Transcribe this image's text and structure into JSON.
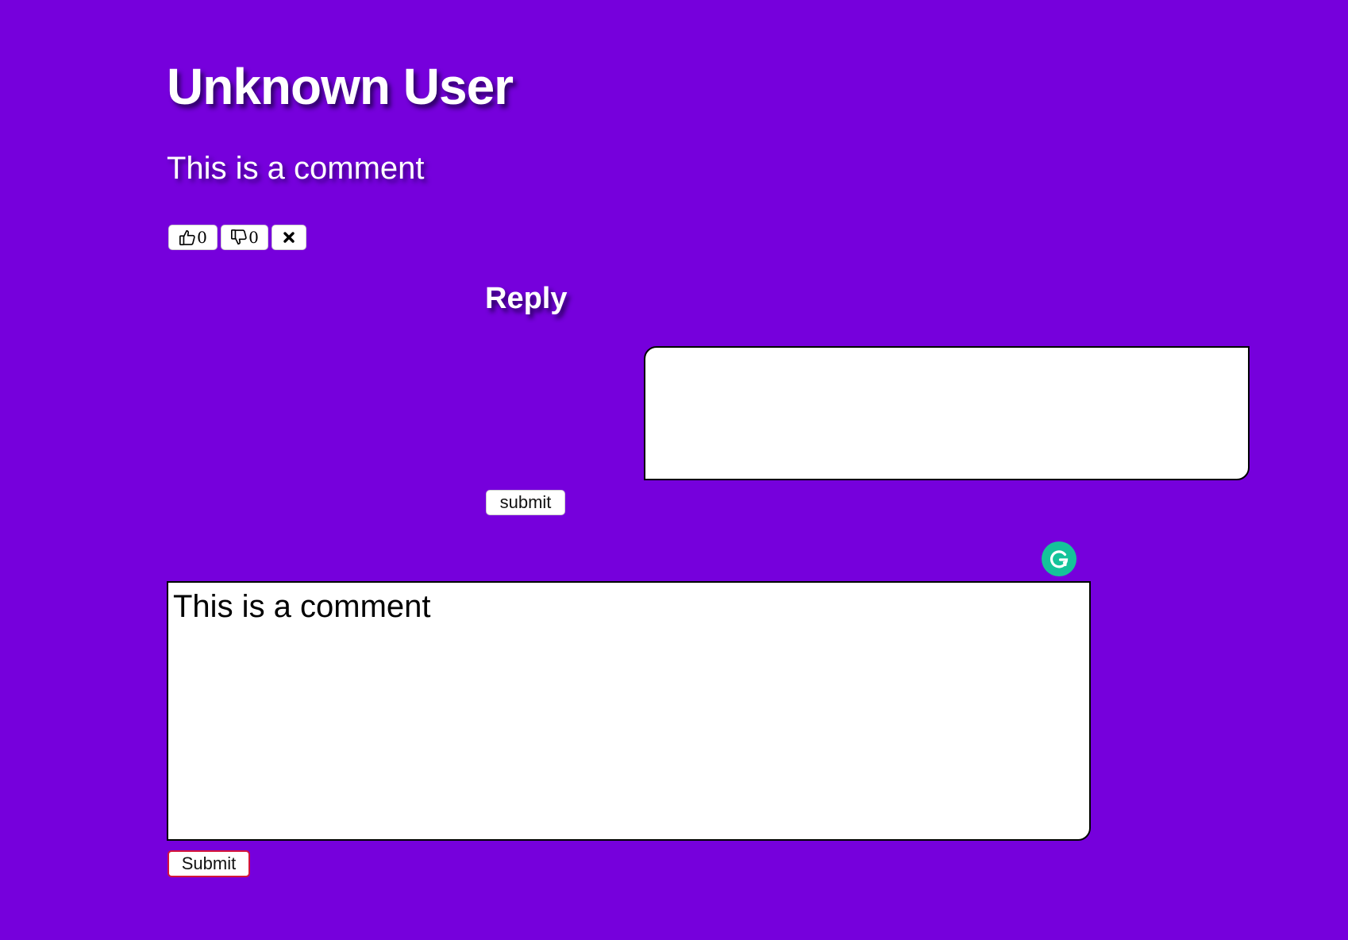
{
  "comment": {
    "author": "Unknown User",
    "text": "This is a comment",
    "likes": "0",
    "dislikes": "0"
  },
  "reply": {
    "heading": "Reply",
    "input_value": "",
    "submit_label": "submit"
  },
  "composer": {
    "input_value": "This is a comment",
    "submit_label": "Submit"
  },
  "icons": {
    "like": "thumbs-up-icon",
    "dislike": "thumbs-down-icon",
    "delete": "close-icon",
    "grammar": "grammarly-icon"
  },
  "colors": {
    "background": "#7600dc",
    "grammar_badge": "#15c39a",
    "submit_border": "#d4153a"
  }
}
